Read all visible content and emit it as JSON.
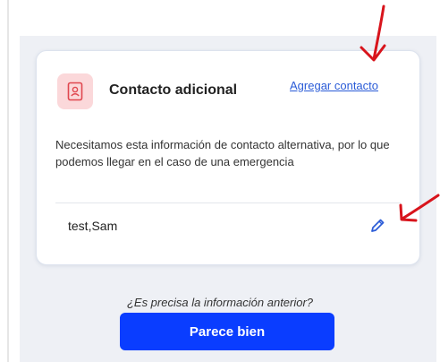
{
  "card": {
    "title": "Contacto adicional",
    "add_link": "Agregar contacto",
    "description": "Necesitamos esta información de contacto alternativa, por lo que podemos llegar en el caso de una emergencia",
    "contact_name": "test,Sam"
  },
  "footer": {
    "question": "¿Es precisa la información anterior?",
    "confirm_label": "Parece bien"
  },
  "icons": {
    "contact": "contact-card-icon",
    "edit": "pencil-icon",
    "annotation_arrows": "red-arrow-icon"
  },
  "colors": {
    "link": "#2a5bd7",
    "primary_button": "#0a3dff",
    "icon_tile": "#fbd8da",
    "annotation": "#d8141c"
  }
}
